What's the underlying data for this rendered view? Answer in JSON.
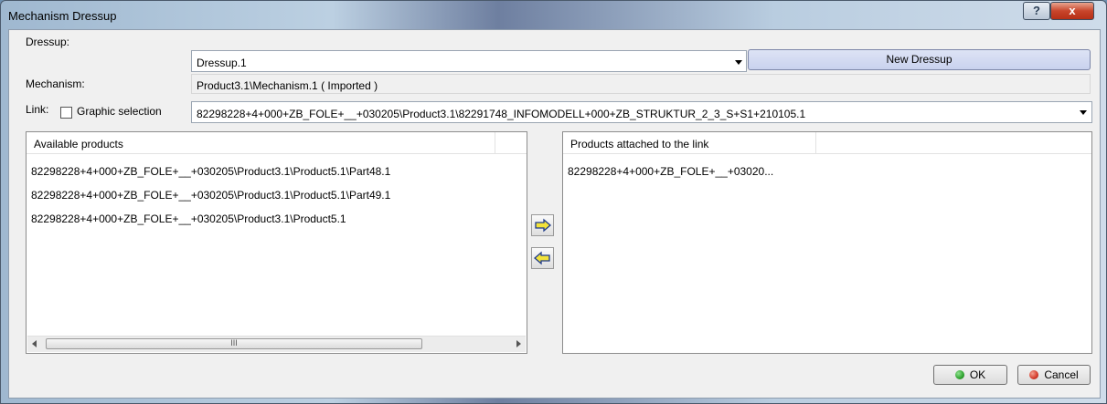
{
  "window": {
    "title": "Mechanism Dressup",
    "help_label": "?",
    "close_label": "x"
  },
  "form": {
    "dressup_label": "Dressup:",
    "dressup_value": "Dressup.1",
    "new_dressup_label": "New Dressup",
    "mechanism_label": "Mechanism:",
    "mechanism_value": "Product3.1\\Mechanism.1 ( Imported )",
    "link_label": "Link:",
    "graphic_selection_label": "Graphic selection",
    "graphic_selection_checked": false,
    "link_value": "82298228+4+000+ZB_FOLE+__+030205\\Product3.1\\82291748_INFOMODELL+000+ZB_STRUKTUR_2_3_S+S1+210105.1"
  },
  "available": {
    "header": "Available products",
    "items": [
      "82298228+4+000+ZB_FOLE+__+030205\\Product3.1\\Product5.1\\Part48.1",
      "82298228+4+000+ZB_FOLE+__+030205\\Product3.1\\Product5.1\\Part49.1",
      "82298228+4+000+ZB_FOLE+__+030205\\Product3.1\\Product5.1"
    ],
    "scroll_thumb_label": "III"
  },
  "attached": {
    "header": "Products attached to the link",
    "items": [
      "82298228+4+000+ZB_FOLE+__+03020..."
    ]
  },
  "buttons": {
    "add_arrow": "⇨",
    "remove_arrow": "⇦",
    "ok_label": "OK",
    "cancel_label": "Cancel"
  },
  "colors": {
    "ok_dot": "#2ea32e",
    "cancel_dot": "#d43a2a",
    "arrow_fill": "#f2e23a"
  }
}
